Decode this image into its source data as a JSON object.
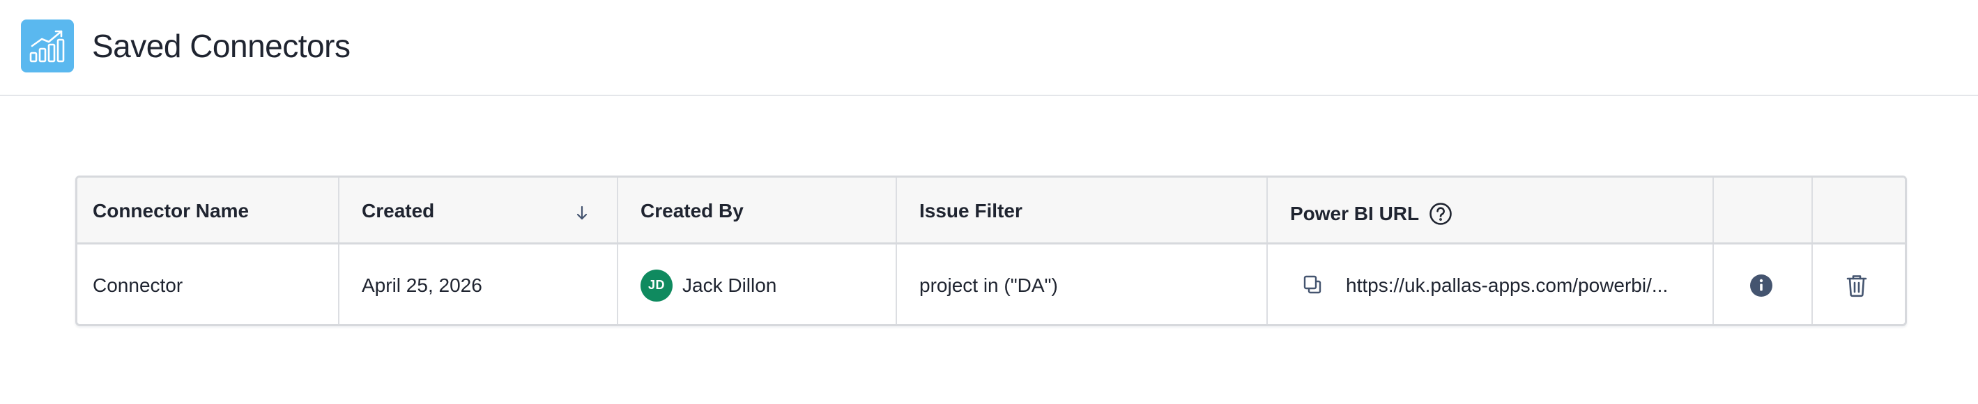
{
  "header": {
    "logo_icon": "bar-chart-trending-up-icon",
    "title": "Saved Connectors",
    "accent_color": "#5ab8ef"
  },
  "table": {
    "columns": [
      {
        "key": "name",
        "label": "Connector Name"
      },
      {
        "key": "created",
        "label": "Created",
        "sort": "descending",
        "sort_icon": "arrow-down-icon"
      },
      {
        "key": "created_by",
        "label": "Created By"
      },
      {
        "key": "issue_filter",
        "label": "Issue Filter"
      },
      {
        "key": "powerbi_url",
        "label": "Power BI URL",
        "help_icon": "question-circle-icon"
      },
      {
        "key": "info",
        "label": ""
      },
      {
        "key": "delete",
        "label": ""
      }
    ],
    "rows": [
      {
        "name": "Connector",
        "created": "April 25, 2026",
        "created_by": {
          "initials": "JD",
          "name": "Jack Dillon",
          "avatar_color": "#0f8a5f"
        },
        "issue_filter": "project in (\"DA\")",
        "powerbi_url": "https://uk.pallas-apps.com/powerbi/...",
        "copy_icon": "copy-icon",
        "info_icon": "info-circle-icon",
        "delete_icon": "trash-icon"
      }
    ]
  }
}
